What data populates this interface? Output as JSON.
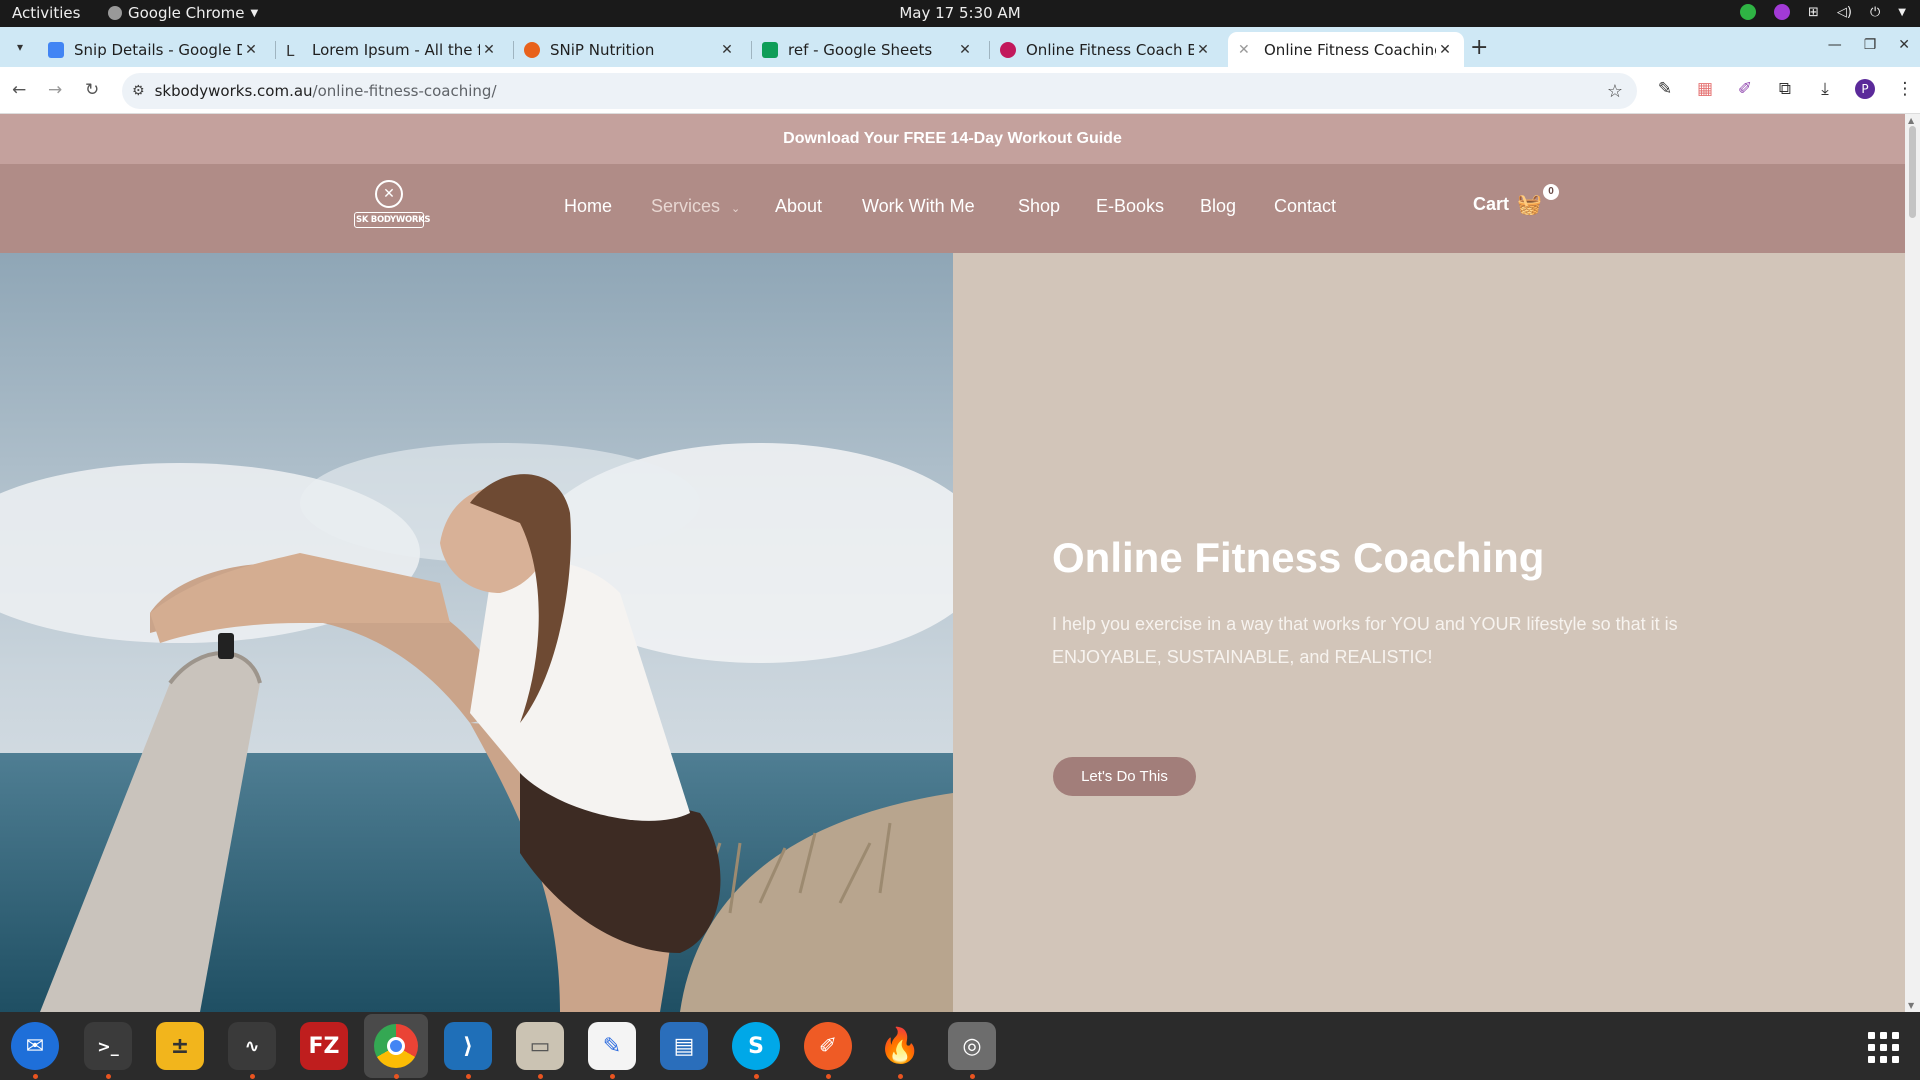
{
  "topbar": {
    "activities": "Activities",
    "app_name": "Google Chrome",
    "clock": "May 17  5:30 AM"
  },
  "tabs": [
    {
      "title": "Snip Details - Google Docs",
      "color": "#4285f4"
    },
    {
      "title": "Lorem Ipsum - All the facts",
      "color": "#333333"
    },
    {
      "title": "SNiP Nutrition",
      "color": "#e8621c"
    },
    {
      "title": "ref - Google Sheets",
      "color": "#0f9d58"
    },
    {
      "title": "Online Fitness Coach Brisbane",
      "color": "#c2185b"
    },
    {
      "title": "Online Fitness Coaching",
      "color": "#9e9e9e"
    }
  ],
  "omnibox": {
    "host": "skbodyworks.com.au",
    "path": "/online-fitness-coaching/"
  },
  "profile_initial": "P",
  "site": {
    "promo": "Download Your FREE 14-Day Workout Guide",
    "logo_text": "SK BODYWORKS",
    "nav": [
      "Home",
      "Services",
      "About",
      "Work With Me",
      "Shop",
      "E-Books",
      "Blog",
      "Contact"
    ],
    "cart_label": "Cart",
    "cart_count": "0",
    "hero_title": "Online Fitness Coaching",
    "hero_sub": "I help you exercise in a way that works for YOU and YOUR lifestyle so that it is ENJOYABLE, SUSTAINABLE, and REALISTIC!",
    "cta": "Let's Do This"
  },
  "colors": {
    "promo_bg": "#c4a19d",
    "nav_bg": "#b08c87",
    "hero_bg": "#d2c5b9",
    "cta_bg": "#a27e7a"
  },
  "dock": [
    {
      "name": "thunderbird-icon"
    },
    {
      "name": "terminal-icon"
    },
    {
      "name": "calculator-icon"
    },
    {
      "name": "system-monitor-icon"
    },
    {
      "name": "filezilla-icon"
    },
    {
      "name": "chrome-icon"
    },
    {
      "name": "vscode-icon"
    },
    {
      "name": "files-icon"
    },
    {
      "name": "text-editor-icon"
    },
    {
      "name": "libreoffice-writer-icon"
    },
    {
      "name": "skype-icon"
    },
    {
      "name": "postman-icon"
    },
    {
      "name": "fire-app-icon"
    },
    {
      "name": "disk-icon"
    }
  ]
}
